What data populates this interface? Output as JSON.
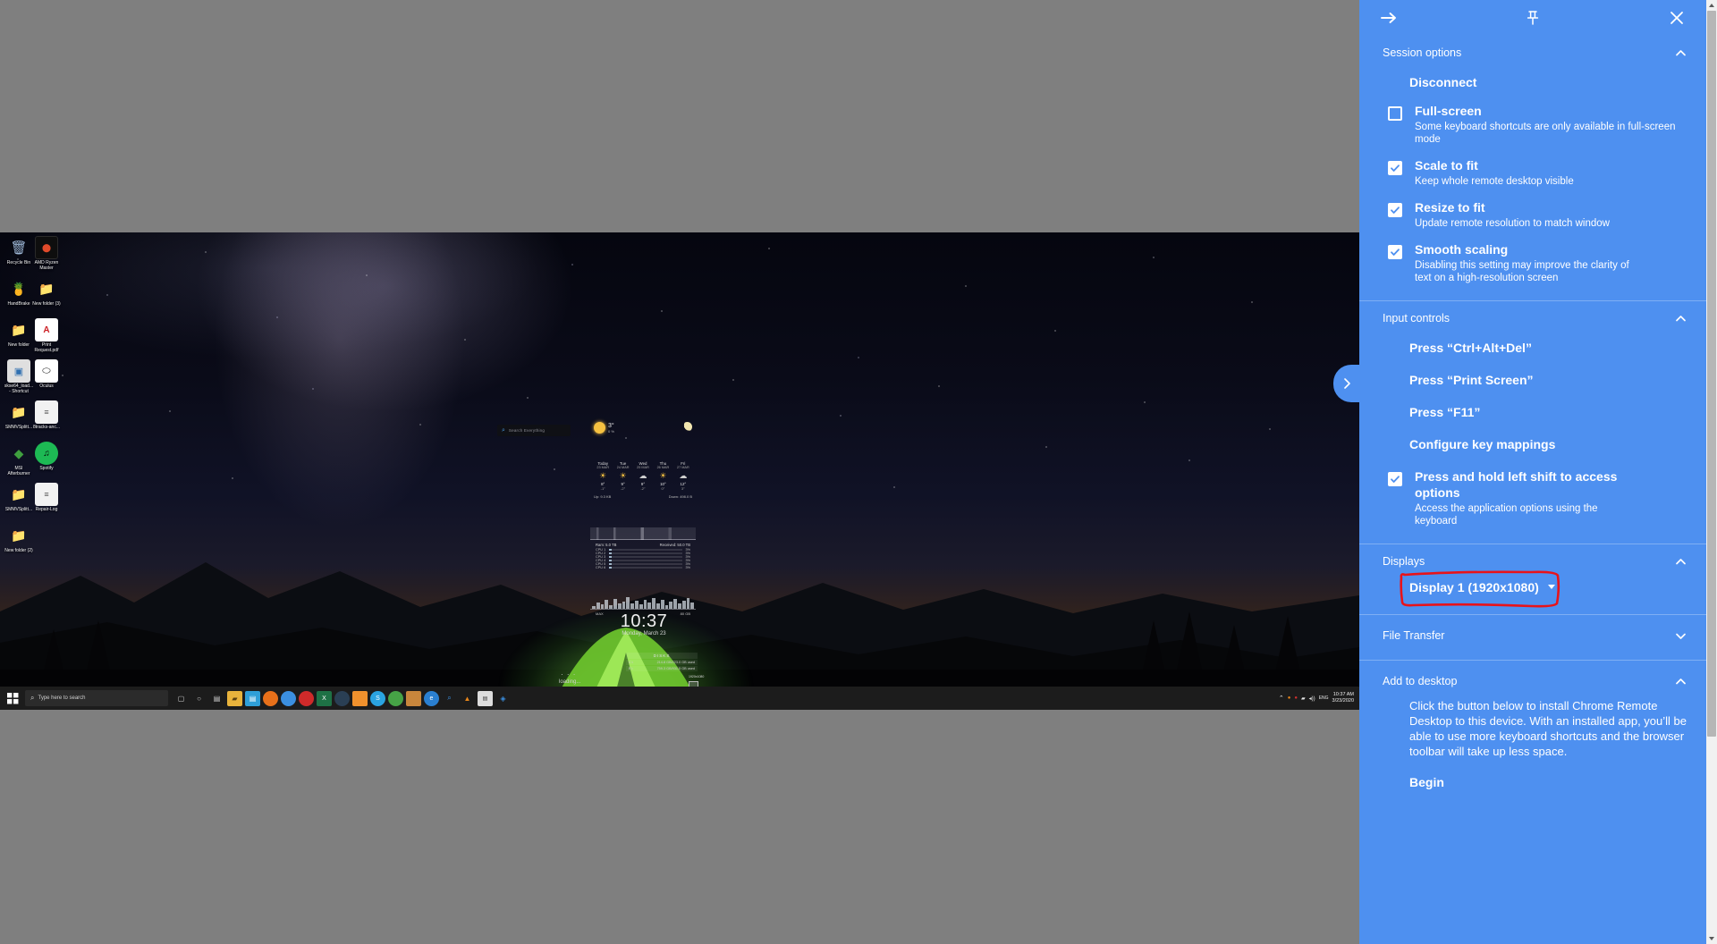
{
  "panel": {
    "header": {
      "back_icon": "arrow-right-icon",
      "pin_icon": "pin-icon",
      "close_icon": "close-icon"
    },
    "sections": [
      {
        "id": "session-options",
        "title": "Session options",
        "expanded": true,
        "chevron": "chevron-up-icon"
      },
      {
        "id": "input-controls",
        "title": "Input controls",
        "expanded": true,
        "chevron": "chevron-up-icon"
      },
      {
        "id": "displays",
        "title": "Displays",
        "expanded": true,
        "chevron": "chevron-up-icon"
      },
      {
        "id": "file-transfer",
        "title": "File Transfer",
        "expanded": false,
        "chevron": "chevron-down-icon"
      },
      {
        "id": "add-to-desktop",
        "title": "Add to desktop",
        "expanded": true,
        "chevron": "chevron-up-icon"
      }
    ],
    "disconnect_label": "Disconnect",
    "session_checkboxes": [
      {
        "label": "Full-screen",
        "description": "Some keyboard shortcuts are only available in full-screen mode",
        "checked": false
      },
      {
        "label": "Scale to fit",
        "description": "Keep whole remote desktop visible",
        "checked": true
      },
      {
        "label": "Resize to fit",
        "description": "Update remote resolution to match window",
        "checked": true
      },
      {
        "label": "Smooth scaling",
        "description": "Disabling this setting may improve the clarity of text on a high-resolution screen",
        "checked": true
      }
    ],
    "input_actions": [
      "Press “Ctrl+Alt+Del”",
      "Press “Print Screen”",
      "Press “F11”",
      "Configure key mappings"
    ],
    "input_checkbox": {
      "label": "Press and hold left shift to access options",
      "description": "Access the application options using the keyboard",
      "checked": true
    },
    "display_selected": "Display 1 (1920x1080)",
    "display_chevron": "caret-down-icon",
    "add_to_desktop_text": "Click the button below to install Chrome Remote Desktop to this device. With an installed app, you’ll be able to use more keyboard shortcuts and the browser toolbar will take up less space.",
    "begin_label": "Begin",
    "accent_color": "#4e90f0",
    "annotation_color": "#e8131a"
  },
  "desktop": {
    "icons": [
      {
        "name": "Recycle Bin",
        "glyph": "🗑",
        "color": "#8fa7c4"
      },
      {
        "name": "AMD Ryzen Master",
        "glyph": "⬤",
        "color": "#1a1a1a"
      },
      {
        "name": "HandBrake",
        "glyph": "🍍",
        "color": "#2c2c2c"
      },
      {
        "name": "New folder (3)",
        "glyph": "📁",
        "color": "#e0a83c"
      },
      {
        "name": "New folder",
        "glyph": "📁",
        "color": "#e0a83c"
      },
      {
        "name": "Print Request.pdf",
        "glyph": "📄",
        "color": "#ffffff"
      },
      {
        "name": "skse64_load... - Shortcut",
        "glyph": "▣",
        "color": "#d8d8d8"
      },
      {
        "name": "Oculus",
        "glyph": "⬭",
        "color": "#ffffff"
      },
      {
        "name": "SMMVSplitt...",
        "glyph": "📁",
        "color": "#e0a83c"
      },
      {
        "name": "8tracks-anc...",
        "glyph": "📄",
        "color": "#ffffff"
      },
      {
        "name": "MSI Afterburner",
        "glyph": "◆",
        "color": "#3c9b3c"
      },
      {
        "name": "Spotify",
        "glyph": "♫",
        "color": "#1db954"
      },
      {
        "name": "SMMVSplitt...",
        "glyph": "📁",
        "color": "#e0a83c"
      },
      {
        "name": "Repair-Log",
        "glyph": "📄",
        "color": "#ffffff"
      },
      {
        "name": "New folder (2)",
        "glyph": "📁",
        "color": "#e0a83c"
      }
    ],
    "search_placeholder": "Search Everything",
    "weather": {
      "current_temp": "3°",
      "precip": "0 %",
      "days": [
        {
          "name": "Today",
          "date": "23 MAR",
          "icon": "☀",
          "hi": "8°",
          "lo": "-1°"
        },
        {
          "name": "Tue",
          "date": "24 MAR",
          "icon": "☀",
          "hi": "9°",
          "lo": "-2°"
        },
        {
          "name": "Wed",
          "date": "25 MAR",
          "icon": "☁",
          "hi": "9°",
          "lo": "-2°"
        },
        {
          "name": "Thu",
          "date": "26 MAR",
          "icon": "☀",
          "hi": "10°",
          "lo": "0°"
        },
        {
          "name": "Fri",
          "date": "27 MAR",
          "icon": "☁",
          "hi": "12°",
          "lo": "3°"
        }
      ],
      "up": "Up: 9.3 KB",
      "down": "Down: 498.0 B"
    },
    "system": {
      "ram_label": "Ram: 5.0 TB",
      "received_label": "Received: 50.0 TB",
      "cpu_rows": [
        {
          "label": "CPU 1",
          "value": "3%"
        },
        {
          "label": "CPU 2",
          "value": "3%"
        },
        {
          "label": "CPU 3",
          "value": "3%"
        },
        {
          "label": "CPU 4",
          "value": "3%"
        },
        {
          "label": "CPU 5",
          "value": "3%"
        },
        {
          "label": "CPU 6",
          "value": "3%"
        }
      ],
      "net_max": "MAX",
      "net_total": "80 GB"
    },
    "clock": {
      "time": "10:37",
      "date": "Monday, March 23"
    },
    "disks": {
      "title": "DISKS",
      "rows": [
        {
          "drive": "C:\\",
          "info": "214.8 GB/223.0 GB used"
        },
        {
          "drive": "E:\\",
          "info": "759.3 GB/931.5 GB used"
        }
      ]
    },
    "status": {
      "dots": "· · ·",
      "loading": "loading...",
      "resolution_badge": "1920x1080"
    }
  },
  "taskbar": {
    "start_icon": "windows-start-icon",
    "search_placeholder": "Type here to search",
    "search_icon": "search-icon",
    "pinned": [
      {
        "name": "task-view-icon",
        "glyph": "□",
        "color": "#cfcfcf"
      },
      {
        "name": "cortana-icon",
        "glyph": "○",
        "color": "#cfcfcf"
      },
      {
        "name": "file-explorer-icon",
        "glyph": "📁",
        "color": "#e8b33c"
      },
      {
        "name": "store-icon",
        "glyph": "⊞",
        "color": "#2f9fd8"
      },
      {
        "name": "firefox-icon",
        "glyph": "●",
        "color": "#e8701a"
      },
      {
        "name": "chrome-icon",
        "glyph": "●",
        "color": "#3b8fe0"
      },
      {
        "name": "opera-icon",
        "glyph": "●",
        "color": "#cf2a2a"
      },
      {
        "name": "excel-icon",
        "glyph": "X",
        "color": "#1e7145"
      },
      {
        "name": "steam-icon",
        "glyph": "●",
        "color": "#2a3f54"
      },
      {
        "name": "discord-icon",
        "glyph": "●",
        "color": "#f0912d"
      },
      {
        "name": "skype-icon",
        "glyph": "S",
        "color": "#2aa3e0"
      },
      {
        "name": "greenshot-icon",
        "glyph": "●",
        "color": "#46a346"
      },
      {
        "name": "photos-icon",
        "glyph": "▣",
        "color": "#c8863c"
      },
      {
        "name": "edge-icon",
        "glyph": "e",
        "color": "#2a7fd0"
      },
      {
        "name": "everything-icon",
        "glyph": "🔍",
        "color": "#3b8fe0"
      },
      {
        "name": "vlc-icon",
        "glyph": "▲",
        "color": "#e8861a"
      },
      {
        "name": "notepad-icon",
        "glyph": "▤",
        "color": "#cfcfcf"
      },
      {
        "name": "rainmeter-icon",
        "glyph": "◈",
        "color": "#3b8fe0"
      }
    ],
    "tray": {
      "chevron": "⌃",
      "icons": [
        "●",
        "●",
        "■",
        "▲",
        "♪"
      ],
      "lang": "ENG",
      "time": "10:37 AM",
      "date": "3/23/2020"
    }
  }
}
